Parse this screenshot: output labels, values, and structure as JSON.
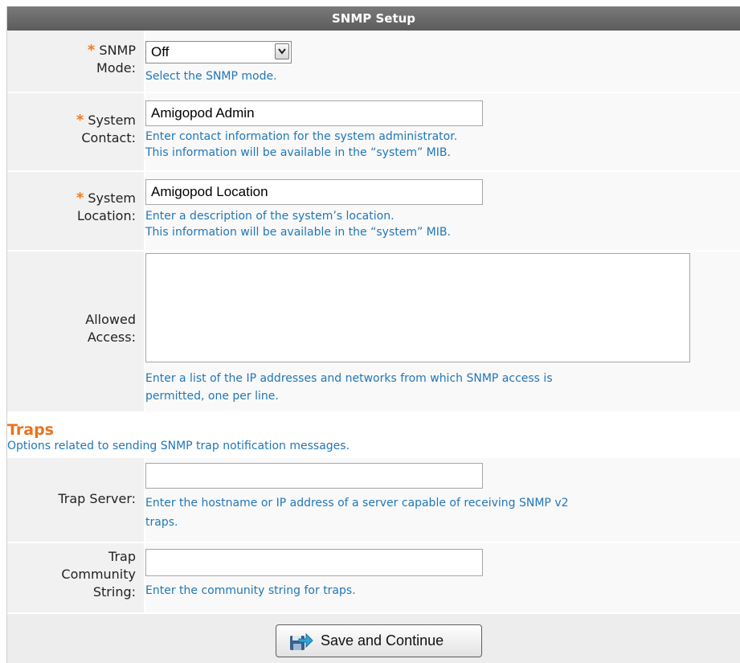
{
  "form": {
    "title": "SNMP Setup"
  },
  "snmp_mode": {
    "label_line1": "SNMP",
    "label_line2": "Mode:",
    "required_mark": "*",
    "selected_value": "Off",
    "hint": "Select the SNMP mode."
  },
  "system_contact": {
    "label_line1": "System",
    "label_line2": "Contact:",
    "required_mark": "*",
    "value": "Amigopod Admin",
    "hint_line1": "Enter contact information for the system administrator.",
    "hint_line2": "This information will be available in the “system” MIB."
  },
  "system_location": {
    "label_line1": "System",
    "label_line2": "Location:",
    "required_mark": "*",
    "value": "Amigopod Location",
    "hint_line1": "Enter a description of the system’s location.",
    "hint_line2": "This information will be available in the “system” MIB."
  },
  "allowed_access": {
    "label_line1": "Allowed",
    "label_line2": "Access:",
    "value": "",
    "hint_line1": "Enter a list of the IP addresses and networks from which SNMP access is",
    "hint_line2": "permitted, one per line."
  },
  "traps_section": {
    "title": "Traps",
    "description": "Options related to sending SNMP trap notification messages."
  },
  "trap_server": {
    "label": "Trap Server:",
    "value": "",
    "hint_line1": "Enter the hostname or IP address of a server capable of receiving SNMP v2",
    "hint_line2": "traps."
  },
  "trap_community": {
    "label_line1": "Trap",
    "label_line2": "Community",
    "label_line3": "String:",
    "value": "",
    "hint": "Enter the community string for traps."
  },
  "actions": {
    "save_label": "Save and Continue"
  },
  "colors": {
    "hint": "#2277b8",
    "required": "#f07a23",
    "section_title": "#e8731e",
    "header_bg": "#666666"
  },
  "icons": {
    "save_button_icon": "save-disk-arrow-icon",
    "select_arrow": "chevron-down-icon"
  }
}
